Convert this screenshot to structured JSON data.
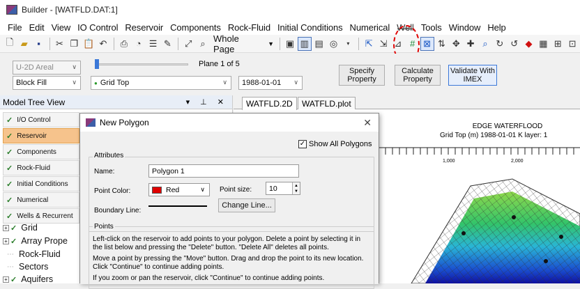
{
  "window": {
    "title": "Builder - [WATFLD.DAT:1]"
  },
  "menu": [
    "File",
    "Edit",
    "View",
    "IO Control",
    "Reservoir",
    "Components",
    "Rock-Fluid",
    "Initial Conditions",
    "Numerical",
    "Well",
    "Tools",
    "Window",
    "Help"
  ],
  "toolbar": {
    "zoom_select": "Whole Page",
    "icons": [
      "new-file-icon",
      "open-file-icon",
      "save-icon",
      "cut-icon",
      "copy-icon",
      "paste-icon",
      "undo-icon",
      "print-icon",
      "reset-icon",
      "properties-icon",
      "edit-icon",
      "fit-icon",
      "zoom-icon",
      "page-setup-icon",
      "grid-view-icon",
      "probe-icon",
      "select-icon",
      "pointer-icon",
      "edit-block-icon",
      "grid-tool-icon",
      "polygon-tool-icon",
      "split-icon",
      "pan-icon",
      "move-icon",
      "zoom-in-icon",
      "rotate-icon",
      "reset-view-icon",
      "box-icon",
      "well-icon",
      "grid-edit-icon",
      "extra-icon"
    ]
  },
  "controls": {
    "view_select": "U-2D Areal",
    "fill_select": "Block Fill",
    "property_select": "Grid Top",
    "plane_label": "Plane 1 of 5",
    "date_select": "1988-01-01",
    "specify_btn": "Specify Property",
    "calculate_btn": "Calculate Property",
    "validate_btn": "Validate With IMEX"
  },
  "model_tree": {
    "title": "Model Tree View",
    "nav": [
      "I/O Control",
      "Reservoir",
      "Components",
      "Rock-Fluid",
      "Initial Conditions",
      "Numerical",
      "Wells & Recurrent"
    ],
    "selected": "Reservoir",
    "tree": [
      "Grid",
      "Array Prope",
      "Rock-Fluid",
      "Sectors",
      "Aquifers"
    ]
  },
  "tabs": [
    "WATFLD.2D",
    "WATFLD.plot"
  ],
  "plot": {
    "title": "EDGE WATERFLOOD",
    "subtitle": "Grid Top (m) 1988-01-01    K layer: 1",
    "ticks": [
      "1,000",
      "2,000"
    ]
  },
  "dialog": {
    "title": "New Polygon",
    "show_all": "Show All Polygons",
    "attributes_label": "Attributes",
    "name_label": "Name:",
    "name_value": "Polygon 1",
    "color_label": "Point Color:",
    "color_value": "Red",
    "size_label": "Point size:",
    "size_value": "10",
    "boundary_label": "Boundary Line:",
    "change_line": "Change Line...",
    "points_label": "Points",
    "instructions": [
      "Left-click on the reservoir to add points to your polygon. Delete a point by selecting it in",
      "the list below and pressing the \"Delete\" button. \"Delete All\" deletes all points.",
      "Move a point by pressing the \"Move\" button. Drag and drop the point to its new location.",
      "Click \"Continue\" to continue adding points.",
      "If you zoom or pan the reservoir, click \"Continue\" to continue adding points."
    ]
  }
}
